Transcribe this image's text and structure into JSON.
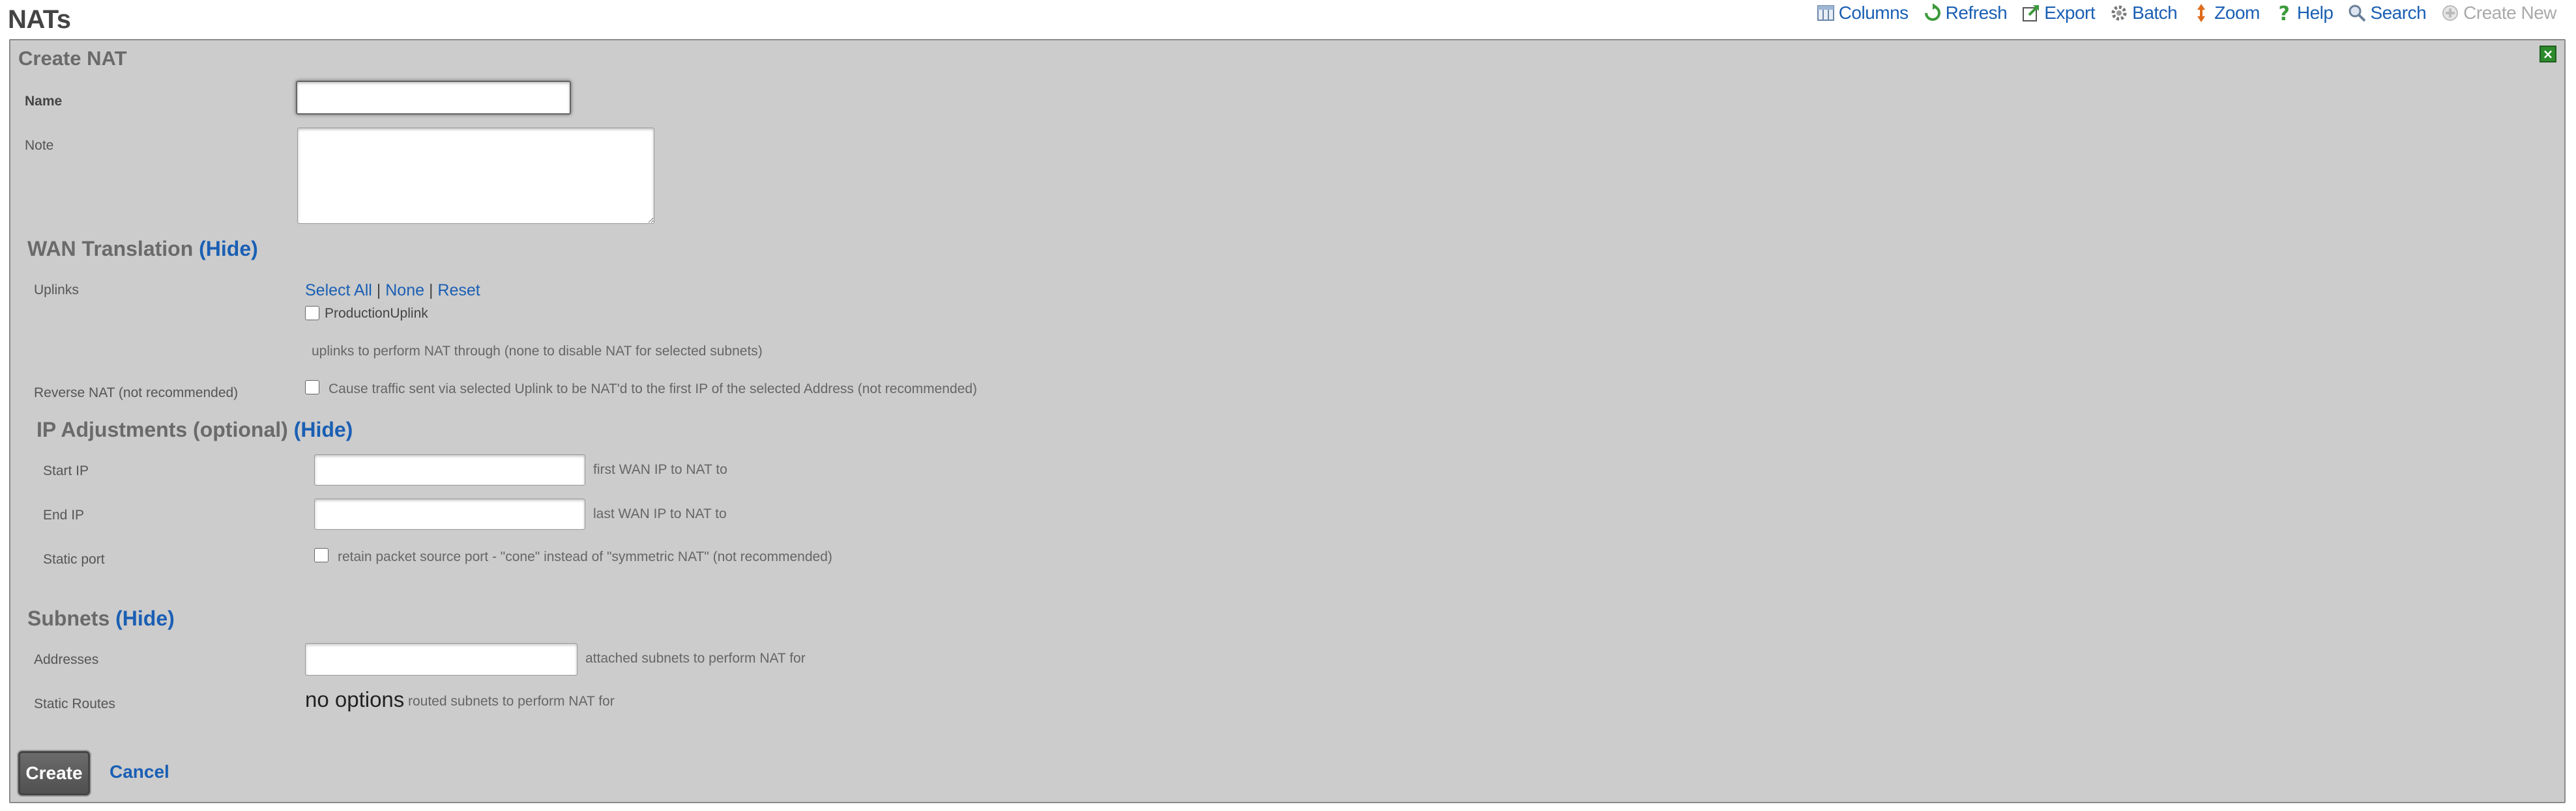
{
  "page": {
    "title": "NATs"
  },
  "toolbar": {
    "columns": "Columns",
    "refresh": "Refresh",
    "export": "Export",
    "batch": "Batch",
    "zoom": "Zoom",
    "help": "Help",
    "search": "Search",
    "create_new": "Create New"
  },
  "panel": {
    "title": "Create NAT",
    "close": "×"
  },
  "form": {
    "name": {
      "label": "Name",
      "value": ""
    },
    "note": {
      "label": "Note",
      "value": ""
    }
  },
  "wan": {
    "title": "WAN Translation",
    "hide": "(Hide)",
    "uplinks_label": "Uplinks",
    "select_all": "Select All",
    "sep": "|",
    "none": "None",
    "reset": "Reset",
    "uplink_option": "ProductionUplink",
    "uplinks_hint": "uplinks to perform NAT through (none to disable NAT for selected subnets)",
    "reverse_label": "Reverse NAT (not recommended)",
    "reverse_hint": "Cause traffic sent via selected Uplink to be NAT'd to the first IP of the selected Address (not recommended)"
  },
  "ip": {
    "title": "IP Adjustments (optional)",
    "hide": "(Hide)",
    "start_label": "Start IP",
    "start_hint": "first WAN IP to NAT to",
    "end_label": "End IP",
    "end_hint": "last WAN IP to NAT to",
    "static_label": "Static port",
    "static_hint": "retain packet source port - \"cone\" instead of \"symmetric NAT\" (not recommended)"
  },
  "subnets": {
    "title": "Subnets",
    "hide": "(Hide)",
    "addresses_label": "Addresses",
    "addresses_hint": "attached subnets to perform NAT for",
    "routes_label": "Static Routes",
    "routes_value": "no options",
    "routes_hint": "routed subnets to perform NAT for"
  },
  "actions": {
    "create": "Create",
    "cancel": "Cancel"
  },
  "colors": {
    "link": "#1a5fb4",
    "panel_bg": "#cccccc",
    "close_bg": "#2d8a2d"
  }
}
